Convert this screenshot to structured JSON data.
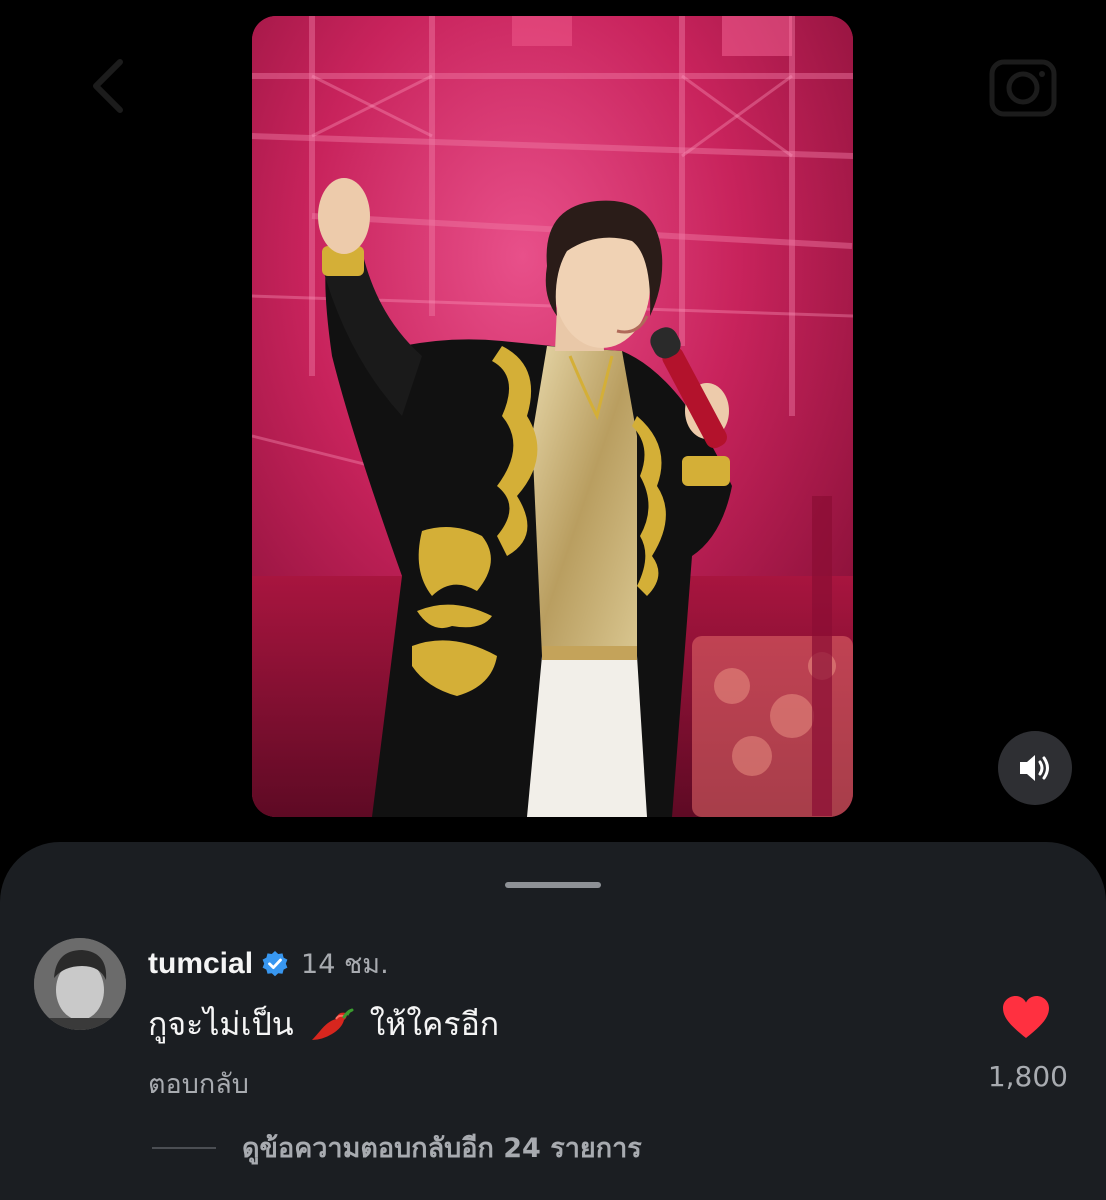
{
  "topbar": {
    "back_icon": "chevron-left-icon",
    "camera_icon": "camera-icon"
  },
  "media": {
    "type": "photo",
    "mute_icon": "speaker-icon",
    "colors": {
      "background": "#c01c55",
      "coat": "#111111",
      "embroidery": "#d4af37",
      "shirt": "#c9b78a",
      "pants": "#f2efe9",
      "microphone": "#b3122c"
    }
  },
  "comment": {
    "username": "tumcial",
    "verified_icon": "verified-badge-icon",
    "time": "14 ชม.",
    "text_before": "กูจะไม่เป็น",
    "emoji": "chili-pepper-emoji",
    "text_after": "ให้ใครอีก",
    "reply_label": "ตอบกลับ",
    "like_icon": "heart-icon",
    "like_count": "1,800",
    "more_replies_label": "ดูข้อความตอบกลับอีก 24 รายการ"
  },
  "colors": {
    "sheet_background": "#1b1e22",
    "heart": "#ff3040",
    "verified": "#3897f0",
    "secondary_text": "#a8abb0"
  }
}
